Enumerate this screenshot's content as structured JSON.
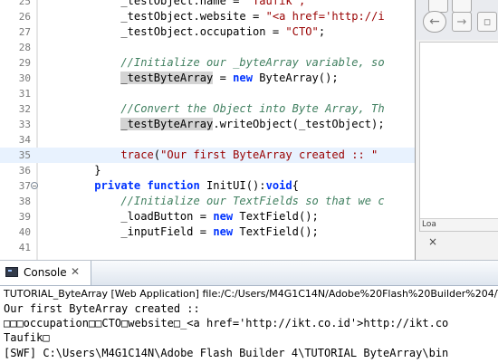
{
  "editor": {
    "lines": [
      {
        "n": "25",
        "seg": [
          [
            "ident",
            "            _testObject.name = "
          ],
          [
            "st",
            "\"Taufik\";"
          ]
        ]
      },
      {
        "n": "26",
        "seg": [
          [
            "ident",
            "            _testObject.website = "
          ],
          [
            "st",
            "\"<a href='http://i"
          ]
        ]
      },
      {
        "n": "27",
        "seg": [
          [
            "ident",
            "            _testObject.occupation = "
          ],
          [
            "st",
            "\"CTO\""
          ],
          [
            "ident",
            ";"
          ]
        ]
      },
      {
        "n": "28",
        "seg": []
      },
      {
        "n": "29",
        "seg": [
          [
            "cm",
            "            //Initialize our _byteArray variable, so"
          ]
        ]
      },
      {
        "n": "30",
        "seg": [
          [
            "ident",
            "            "
          ],
          [
            "occ",
            "_testByteArray"
          ],
          [
            "ident",
            " = "
          ],
          [
            "kw",
            "new"
          ],
          [
            "ident",
            " ByteArray();"
          ]
        ]
      },
      {
        "n": "31",
        "seg": []
      },
      {
        "n": "32",
        "seg": [
          [
            "cm",
            "            //Convert the Object into Byte Array, Th"
          ]
        ]
      },
      {
        "n": "33",
        "seg": [
          [
            "ident",
            "            "
          ],
          [
            "occ",
            "_testByteArray"
          ],
          [
            "ident",
            ".writeObject(_testObject);"
          ]
        ]
      },
      {
        "n": "34",
        "seg": []
      },
      {
        "n": "35",
        "hl": true,
        "seg": [
          [
            "ident",
            "            "
          ],
          [
            "tr",
            "trace"
          ],
          [
            "ident",
            "("
          ],
          [
            "st",
            "\"Our first ByteArray created :: \""
          ]
        ]
      },
      {
        "n": "36",
        "seg": [
          [
            "ident",
            "        }"
          ]
        ]
      },
      {
        "n": "37",
        "fold": true,
        "seg": [
          [
            "ident",
            "        "
          ],
          [
            "kw",
            "private"
          ],
          [
            "ident",
            " "
          ],
          [
            "kw",
            "function"
          ],
          [
            "ident",
            " InitUI():"
          ],
          [
            "kw",
            "void"
          ],
          [
            "ident",
            "{"
          ]
        ]
      },
      {
        "n": "38",
        "seg": [
          [
            "cm",
            "            //Initialize our TextFields so that we c"
          ]
        ]
      },
      {
        "n": "39",
        "seg": [
          [
            "ident",
            "            _loadButton = "
          ],
          [
            "kw",
            "new"
          ],
          [
            "ident",
            " TextField();"
          ]
        ]
      },
      {
        "n": "40",
        "seg": [
          [
            "ident",
            "            _inputField = "
          ],
          [
            "kw",
            "new"
          ],
          [
            "ident",
            " TextField();"
          ]
        ]
      },
      {
        "n": "41",
        "seg": []
      }
    ]
  },
  "browser": {
    "back_icon": "back-arrow-icon",
    "status_text": "Loa",
    "close_label": "×"
  },
  "console": {
    "tab_label": "Console",
    "tab_close": "✕",
    "info": "TUTORIAL_ByteArray [Web Application] file:/C:/Users/M4G1C14N/Adobe%20Flash%20Builder%204/TUT",
    "output": [
      "Our first ByteArray created ::",
      "□□□occupation□□CTO□website□_<a href='http://ikt.co.id'>http://ikt.co",
      "Taufik□",
      "[SWF] C:\\Users\\M4G1C14N\\Adobe Flash Builder 4\\TUTORIAL ByteArray\\bin"
    ]
  },
  "colors": {
    "keyword": "#0033ff",
    "comment": "#3f7f5f",
    "string": "#990000",
    "highlight_line": "#e8f2fe",
    "occurrence": "#d4d4d4"
  }
}
